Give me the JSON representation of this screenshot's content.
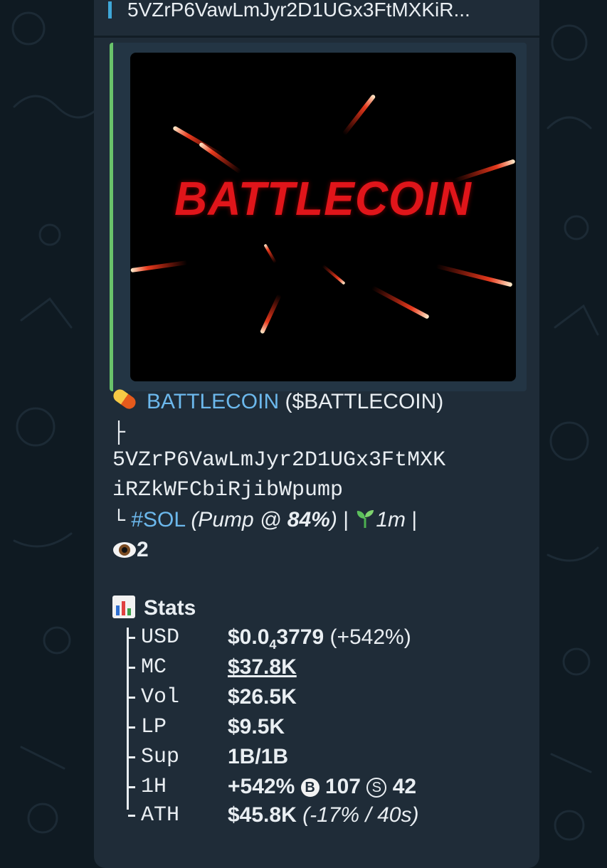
{
  "reply_preview": {
    "text": "5VZrP6VawLmJyr2D1UGx3FtMXKiR..."
  },
  "media": {
    "logo_text": "BATTLECOIN"
  },
  "token": {
    "name": "BATTLECOIN",
    "ticker": "($BATTLECOIN)",
    "tree_top": "├",
    "address_line1": "5VZrP6VawLmJyr2D1UGx3FtMXK",
    "address_line2": "iRZkWFCbiRjibWpump",
    "tree_bottom": "└",
    "chain_tag": "#SOL",
    "pump_prefix": "(Pump @ ",
    "pump_percent": "84%",
    "pump_suffix": ")",
    "separator1": "|",
    "age": "1m",
    "separator2": "|",
    "views": "2"
  },
  "stats": {
    "title": "Stats",
    "rows": [
      {
        "label": "USD",
        "value_main": "$0.0",
        "value_sub": "4",
        "value_rest": "3779",
        "value_extra": " (+542%)"
      },
      {
        "label": "MC",
        "value": "$37.8K"
      },
      {
        "label": "Vol",
        "value": "$26.5K"
      },
      {
        "label": "LP",
        "value": "$9.5K"
      },
      {
        "label": "Sup",
        "value": "1B/1B"
      },
      {
        "label": "1H",
        "value": "+542%",
        "buys_badge": "B",
        "buys": "107",
        "sells_badge": "S",
        "sells": "42"
      },
      {
        "label": "ATH",
        "value": "$45.8K",
        "value_extra": " (-17% / 40s)"
      }
    ]
  },
  "colors": {
    "background": "#0f1a22",
    "bubble": "#1f2c38",
    "link": "#6cb8ec",
    "reply_bar": "#3fa7d8",
    "media_bar": "#69c26a",
    "logo_red": "#e0151a"
  }
}
